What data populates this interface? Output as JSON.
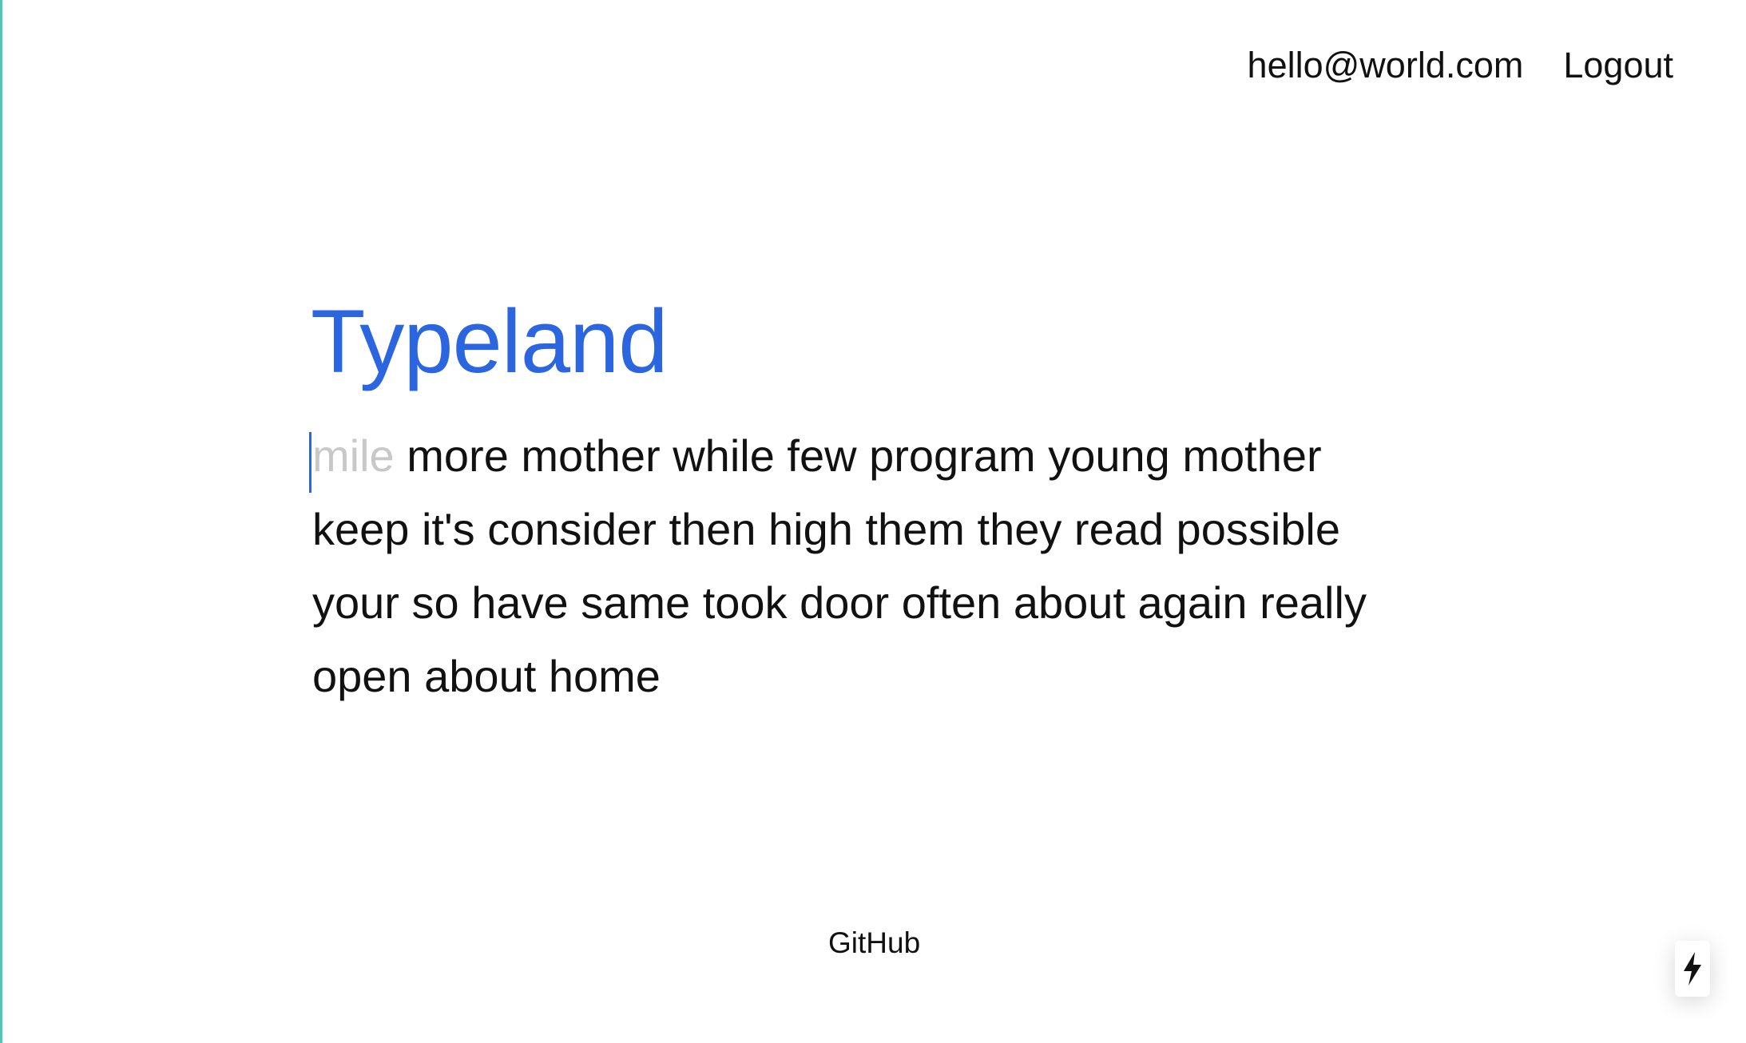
{
  "header": {
    "email": "hello@world.com",
    "logout_label": "Logout"
  },
  "main": {
    "title": "Typeland",
    "typing": {
      "current_word": "mile",
      "remaining_text": "more mother while few program young mother keep it's consider then high them they read possible your so have same took door often about again really open about home"
    }
  },
  "footer": {
    "github_label": "GitHub"
  },
  "icons": {
    "badge": "lightning-bolt-icon"
  },
  "colors": {
    "accent": "#2b66e0",
    "text": "#111111",
    "pending_text": "#c8c8c8",
    "edge": "#52c6b8"
  }
}
